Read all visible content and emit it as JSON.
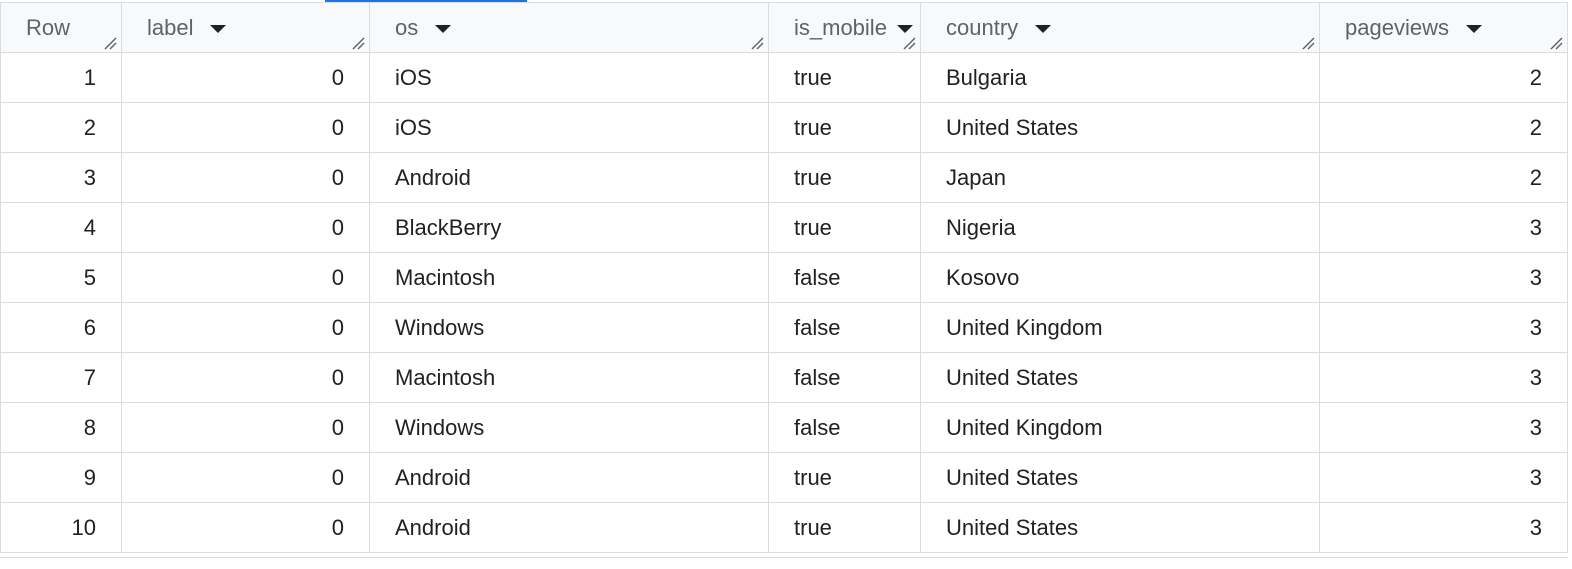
{
  "columns": [
    {
      "key": "row",
      "label": "Row",
      "sortable": false
    },
    {
      "key": "label",
      "label": "label",
      "sortable": true
    },
    {
      "key": "os",
      "label": "os",
      "sortable": true
    },
    {
      "key": "is_mobile",
      "label": "is_mobile",
      "sortable": true
    },
    {
      "key": "country",
      "label": "country",
      "sortable": true
    },
    {
      "key": "pageviews",
      "label": "pageviews",
      "sortable": true
    }
  ],
  "rows": [
    {
      "row": "1",
      "label": "0",
      "os": "iOS",
      "is_mobile": "true",
      "country": "Bulgaria",
      "pageviews": "2"
    },
    {
      "row": "2",
      "label": "0",
      "os": "iOS",
      "is_mobile": "true",
      "country": "United States",
      "pageviews": "2"
    },
    {
      "row": "3",
      "label": "0",
      "os": "Android",
      "is_mobile": "true",
      "country": "Japan",
      "pageviews": "2"
    },
    {
      "row": "4",
      "label": "0",
      "os": "BlackBerry",
      "is_mobile": "true",
      "country": "Nigeria",
      "pageviews": "3"
    },
    {
      "row": "5",
      "label": "0",
      "os": "Macintosh",
      "is_mobile": "false",
      "country": "Kosovo",
      "pageviews": "3"
    },
    {
      "row": "6",
      "label": "0",
      "os": "Windows",
      "is_mobile": "false",
      "country": "United Kingdom",
      "pageviews": "3"
    },
    {
      "row": "7",
      "label": "0",
      "os": "Macintosh",
      "is_mobile": "false",
      "country": "United States",
      "pageviews": "3"
    },
    {
      "row": "8",
      "label": "0",
      "os": "Windows",
      "is_mobile": "false",
      "country": "United Kingdom",
      "pageviews": "3"
    },
    {
      "row": "9",
      "label": "0",
      "os": "Android",
      "is_mobile": "true",
      "country": "United States",
      "pageviews": "3"
    },
    {
      "row": "10",
      "label": "0",
      "os": "Android",
      "is_mobile": "true",
      "country": "United States",
      "pageviews": "3"
    }
  ],
  "colors": {
    "accent": "#1a73e8",
    "border": "#dadce0",
    "header_bg": "#f8f9fa",
    "header_text": "#5f6368",
    "text": "#202124"
  }
}
